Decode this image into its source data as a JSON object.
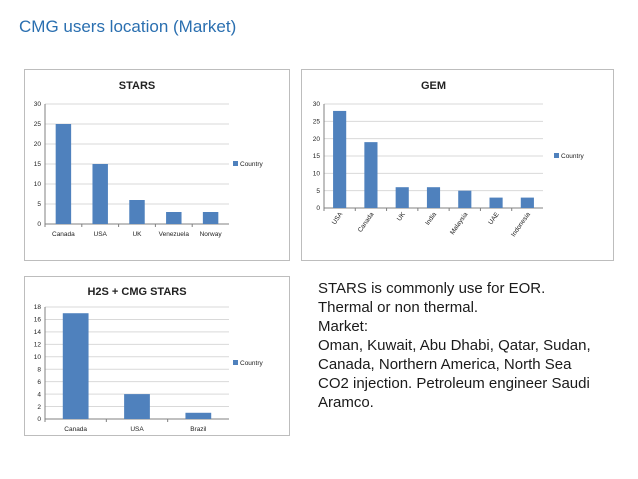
{
  "slide": {
    "title": "CMG users location (Market)"
  },
  "colors": {
    "bar": "#4f81bd",
    "grid": "#d9d9d9",
    "axis": "#808080",
    "text": "#222222",
    "title_color": "#2a6fb0"
  },
  "chart_data": [
    {
      "type": "bar",
      "title": "STARS",
      "categories": [
        "Canada",
        "USA",
        "UK",
        "Venezuela",
        "Norway"
      ],
      "series": [
        {
          "name": "Country",
          "values": [
            25,
            15,
            6,
            3,
            3
          ]
        }
      ],
      "ylim": [
        0,
        30
      ],
      "yticks": [
        0,
        5,
        10,
        15,
        20,
        25,
        30
      ],
      "grid": true,
      "legend": "right",
      "xlabel": "",
      "ylabel": ""
    },
    {
      "type": "bar",
      "title": "GEM",
      "categories": [
        "USA",
        "Canada",
        "UK",
        "India",
        "Malaysia",
        "UAE",
        "Indonesia"
      ],
      "series": [
        {
          "name": "Country",
          "values": [
            28,
            19,
            6,
            6,
            5,
            3,
            3
          ]
        }
      ],
      "ylim": [
        0,
        30
      ],
      "yticks": [
        0,
        5,
        10,
        15,
        20,
        25,
        30
      ],
      "grid": true,
      "legend": "right",
      "xlabel": "",
      "ylabel": ""
    },
    {
      "type": "bar",
      "title": "H2S + CMG STARS",
      "categories": [
        "Canada",
        "USA",
        "Brazil"
      ],
      "series": [
        {
          "name": "Country",
          "values": [
            17,
            4,
            1
          ]
        }
      ],
      "ylim": [
        0,
        18
      ],
      "yticks": [
        0,
        2,
        4,
        6,
        8,
        10,
        12,
        14,
        16,
        18
      ],
      "grid": true,
      "legend": "right",
      "xlabel": "",
      "ylabel": ""
    }
  ],
  "note": {
    "lines": [
      "STARS is commonly use for EOR.",
      "Thermal or non thermal.",
      "Market:",
      "Oman, Kuwait, Abu Dhabi, Qatar, Sudan,",
      "Canada, Northern America, North Sea",
      "CO2 injection. Petroleum engineer Saudi",
      "Aramco."
    ]
  }
}
